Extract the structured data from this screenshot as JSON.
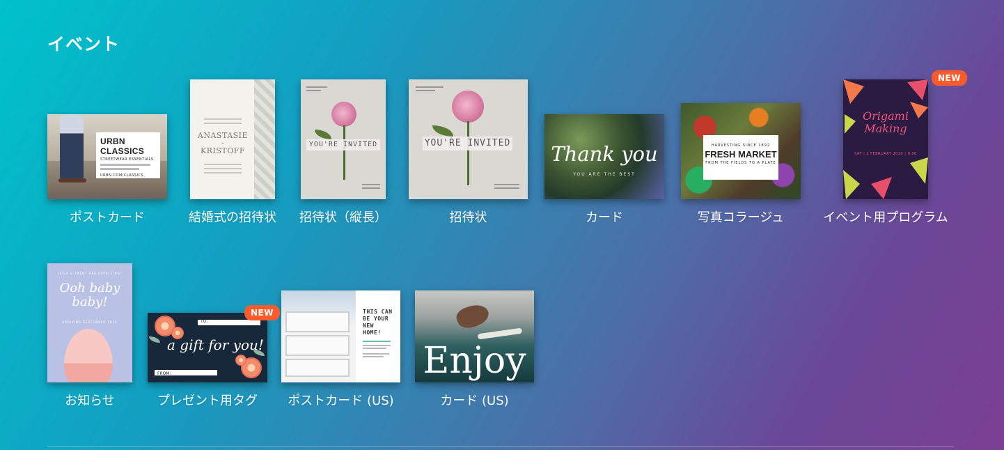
{
  "section": {
    "title": "イベント"
  },
  "tiles": [
    {
      "label": "ポストカード",
      "thumb": {
        "title": "URBN CLASSICS",
        "subtitle": "STREETWEAR ESSENTIALS",
        "footer": "URBN.COM/CLASSICS"
      }
    },
    {
      "label": "結婚式の招待状",
      "thumb": {
        "name1": "ANASTASIE",
        "amp": "&",
        "name2": "KRISTOFF"
      }
    },
    {
      "label": "招待状（縦長）",
      "thumb": {
        "text": "YOU'RE INVITED"
      }
    },
    {
      "label": "招待状",
      "thumb": {
        "text": "YOU'RE INVITED"
      }
    },
    {
      "label": "カード",
      "thumb": {
        "text": "Thank you",
        "sub": "YOU ARE THE BEST"
      }
    },
    {
      "label": "写真コラージュ",
      "thumb": {
        "top": "HARVESTING SINCE 1892",
        "title": "FRESH MARKET",
        "bottom": "FROM THE FIELDS TO A PLATE"
      }
    },
    {
      "label": "イベント用プログラム",
      "badge": "NEW",
      "thumb": {
        "line1": "Origami",
        "line2": "Making",
        "date": "SAT | 2 FEBRUARY 2019 | 9:00"
      }
    },
    {
      "label": "お知らせ",
      "thumb": {
        "top": "LEILA & TRENT ARE EXPECTING!",
        "line1": "Ooh baby",
        "line2": "baby!",
        "bottom": "ARRIVING SEPTEMBER 2020"
      }
    },
    {
      "label": "プレゼント用タグ",
      "badge": "NEW",
      "thumb": {
        "text": "a gift for you!",
        "to": "TO:",
        "from": "FROM:"
      }
    },
    {
      "label": "ポストカード (US)",
      "thumb": {
        "title": "THIS CAN BE YOUR NEW HOME!"
      }
    },
    {
      "label": "カード (US)",
      "thumb": {
        "text": "Enjoy"
      }
    }
  ]
}
